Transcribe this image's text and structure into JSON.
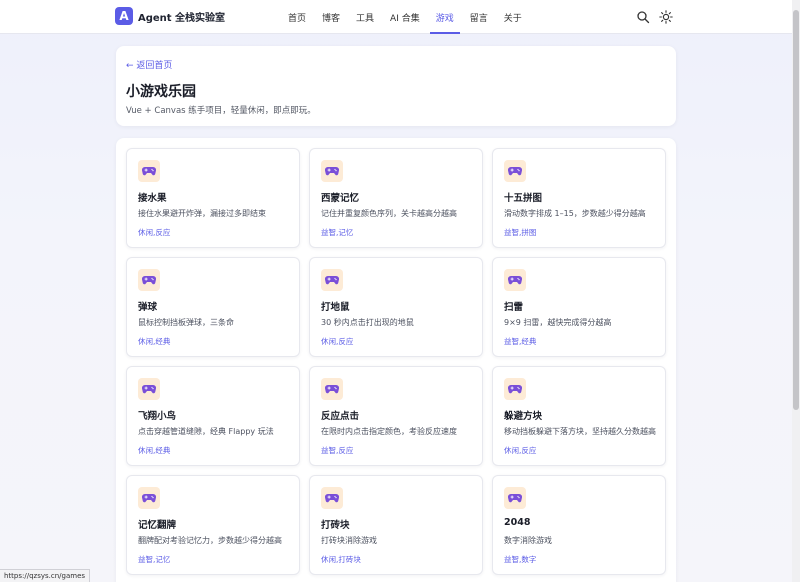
{
  "header": {
    "logo_letter": "A",
    "brand": "Agent 全栈实验室",
    "nav": [
      {
        "label": "首页",
        "active": false
      },
      {
        "label": "博客",
        "active": false
      },
      {
        "label": "工具",
        "active": false
      },
      {
        "label": "AI 合集",
        "active": false
      },
      {
        "label": "游戏",
        "active": true
      },
      {
        "label": "留言",
        "active": false
      },
      {
        "label": "关于",
        "active": false
      }
    ],
    "icons": [
      "search-icon",
      "sun-icon"
    ]
  },
  "hero": {
    "back_link": "← 返回首页",
    "title": "小游戏乐园",
    "subtitle": "Vue + Canvas 练手项目，轻量休闲，即点即玩。"
  },
  "games": [
    {
      "title": "接水果",
      "desc": "接住水果避开炸弹，漏接过多即结束",
      "tags": "休闲,反应"
    },
    {
      "title": "西蒙记忆",
      "desc": "记住并重复颜色序列，关卡越高分越高",
      "tags": "益智,记忆"
    },
    {
      "title": "十五拼图",
      "desc": "滑动数字排成 1–15，步数越少得分越高",
      "tags": "益智,拼图"
    },
    {
      "title": "弹球",
      "desc": "鼠标控制挡板弹球，三条命",
      "tags": "休闲,经典"
    },
    {
      "title": "打地鼠",
      "desc": "30 秒内点击打出现的地鼠",
      "tags": "休闲,反应"
    },
    {
      "title": "扫雷",
      "desc": "9×9 扫雷，越快完成得分越高",
      "tags": "益智,经典"
    },
    {
      "title": "飞翔小鸟",
      "desc": "点击穿越管道缝隙，经典 Flappy 玩法",
      "tags": "休闲,经典"
    },
    {
      "title": "反应点击",
      "desc": "在限时内点击指定颜色，考验反应速度",
      "tags": "益智,反应"
    },
    {
      "title": "躲避方块",
      "desc": "移动挡板躲避下落方块，坚持越久分数越高",
      "tags": "休闲,反应"
    },
    {
      "title": "记忆翻牌",
      "desc": "翻牌配对考验记忆力，步数越少得分越高",
      "tags": "益智,记忆"
    },
    {
      "title": "打砖块",
      "desc": "打砖块消除游戏",
      "tags": "休闲,打砖块"
    },
    {
      "title": "2048",
      "desc": "数字消除游戏",
      "tags": "益智,数字"
    }
  ],
  "status_url": "https://qzsys.cn/games",
  "colors": {
    "accent": "#5b5ce6",
    "icon_bg": "#fdebd6",
    "gamepad": "#7a4fd8"
  }
}
